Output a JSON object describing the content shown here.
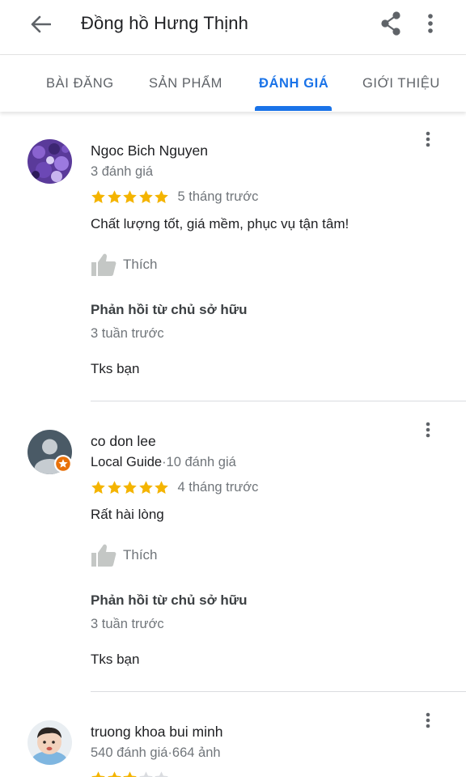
{
  "header": {
    "title": "Đồng hồ Hưng Thịnh",
    "back_icon": "arrow-back-icon",
    "share_icon": "share-icon",
    "more_icon": "more-vert-icon"
  },
  "tabs": [
    {
      "label": "BÀI ĐĂNG"
    },
    {
      "label": "SẢN PHẨM"
    },
    {
      "label": "ĐÁNH GIÁ"
    },
    {
      "label": "GIỚI THIỆU"
    }
  ],
  "colors": {
    "accent": "#1a73e8",
    "star": "#f4b400",
    "star_empty": "#dadce0"
  },
  "reviews": [
    {
      "name": "Ngoc Bich Nguyen",
      "meta": "3 đánh giá",
      "rating": 5,
      "when": "5 tháng trước",
      "text": "Chất lượng tốt, giá mềm, phục vụ tận tâm!",
      "like_label": "Thích",
      "owner_heading": "Phản hồi từ chủ sở hữu",
      "owner_when": "3 tuần trước",
      "owner_reply": "Tks bạn"
    },
    {
      "name": "co don lee",
      "local_guide": "Local Guide",
      "meta": "·10 đánh giá",
      "rating": 5,
      "when": "4 tháng trước",
      "text": "Rất hài lòng",
      "like_label": "Thích",
      "owner_heading": "Phản hồi từ chủ sở hữu",
      "owner_when": "3 tuần trước",
      "owner_reply": "Tks bạn"
    },
    {
      "name": "truong khoa bui minh",
      "meta": "540 đánh giá·664 ảnh",
      "rating": 3
    }
  ]
}
